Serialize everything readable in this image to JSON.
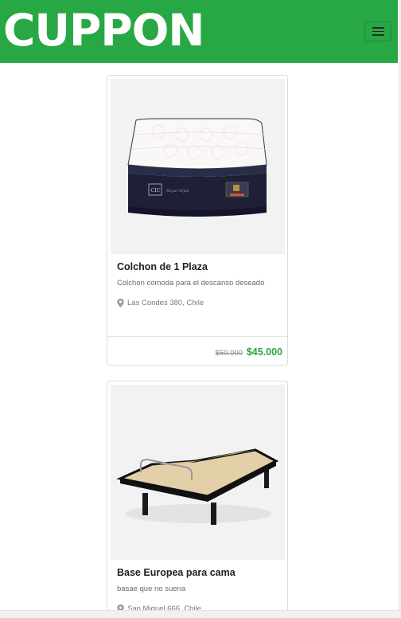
{
  "navbar": {
    "brand": "CUPPON",
    "menu_icon": "hamburger-menu-icon",
    "background_color": "#27a844"
  },
  "products": [
    {
      "title": "Colchon de 1 Plaza",
      "description": "Colchon comoda para el descanso deseado",
      "location": "Las Condes 380, Chile",
      "old_price": "$50.000",
      "new_price": "$45.000",
      "image": "mattress-image"
    },
    {
      "title": "Base Europea para cama",
      "description": "basae que no suena",
      "location": "San Miguel 666, Chile",
      "image": "bed-base-image"
    }
  ],
  "colors": {
    "price_accent": "#27a844"
  }
}
